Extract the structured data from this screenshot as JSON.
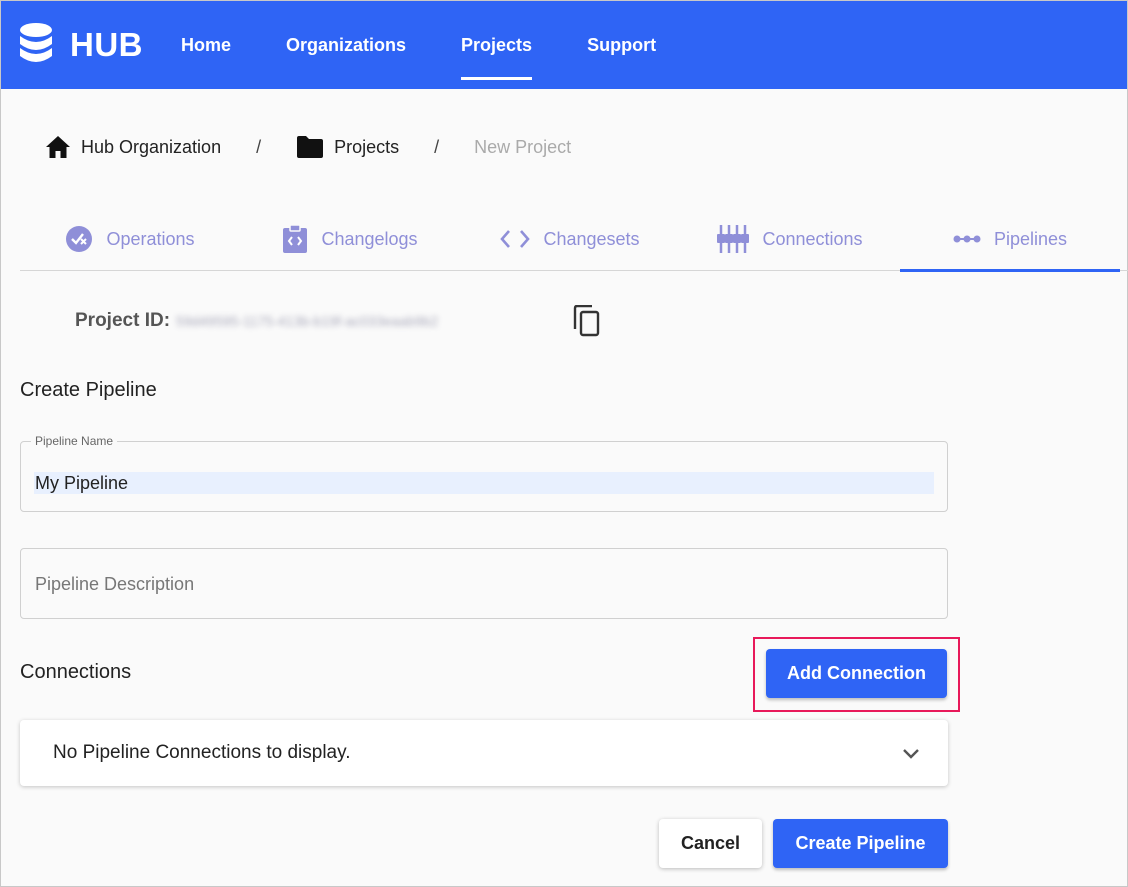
{
  "header": {
    "logo_text": "HUB",
    "nav": [
      {
        "label": "Home",
        "active": false
      },
      {
        "label": "Organizations",
        "active": false
      },
      {
        "label": "Projects",
        "active": true
      },
      {
        "label": "Support",
        "active": false
      }
    ],
    "colors": {
      "brand": "#2f64f5"
    }
  },
  "breadcrumb": {
    "items": [
      {
        "label": "Hub Organization",
        "icon": "home-icon"
      },
      {
        "label": "Projects",
        "icon": "folder-icon"
      },
      {
        "label": "New Project",
        "icon": null
      }
    ],
    "separator": "/"
  },
  "tabs": [
    {
      "label": "Operations",
      "icon": "operations-icon",
      "active": false
    },
    {
      "label": "Changelogs",
      "icon": "changelog-icon",
      "active": false
    },
    {
      "label": "Changesets",
      "icon": "code-icon",
      "active": false
    },
    {
      "label": "Connections",
      "icon": "connections-icon",
      "active": false
    },
    {
      "label": "Pipelines",
      "icon": "pipeline-icon",
      "active": true
    }
  ],
  "project": {
    "id_label": "Project ID:",
    "id_value": "59d49595-1175-413b-b19f-ac033eaab9b2"
  },
  "form": {
    "title": "Create Pipeline",
    "name_label": "Pipeline Name",
    "name_value": "My Pipeline",
    "description_placeholder": "Pipeline Description"
  },
  "connections": {
    "title": "Connections",
    "add_button": "Add Connection",
    "empty_text": "No Pipeline Connections to display."
  },
  "actions": {
    "cancel": "Cancel",
    "create": "Create Pipeline"
  }
}
